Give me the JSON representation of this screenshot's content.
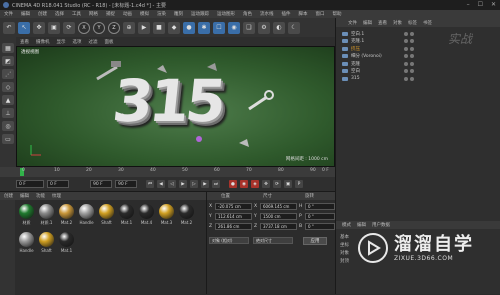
{
  "window": {
    "title": "CINEMA 4D R18.041 Studio (RC - R18) - [未标题-1.c4d *] - 主要"
  },
  "menubar": [
    "文件",
    "编辑",
    "创建",
    "选择",
    "工具",
    "网格",
    "捕捉",
    "动画",
    "模拟",
    "渲染",
    "雕刻",
    "运动跟踪",
    "运动图形",
    "角色",
    "流水线",
    "插件",
    "脚本",
    "窗口",
    "帮助"
  ],
  "toolbar": {
    "buttons": [
      "↶",
      "↖",
      "✥",
      "▣",
      "⟳"
    ],
    "axes": [
      "X",
      "Y",
      "Z"
    ],
    "more": [
      "⊕",
      "▶",
      "■",
      "◆",
      "●",
      "✱",
      "☐",
      "◉",
      "❑",
      "⚙",
      "◐",
      "☾"
    ]
  },
  "viewport": {
    "menu": [
      "查看",
      "摄像机",
      "显示",
      "选项",
      "过滤",
      "面板"
    ],
    "label": "透视视图",
    "main_text": "315",
    "grid_info": "网格间距 : 1000 cm"
  },
  "objects": {
    "menu": [
      "文件",
      "编辑",
      "查看",
      "对象",
      "标签",
      "书签"
    ],
    "rows": [
      {
        "name": "空白.1",
        "highlight": false
      },
      {
        "name": "克隆.1",
        "highlight": false
      },
      {
        "name": "挤压",
        "highlight": true
      },
      {
        "name": "细分 (Voronoi)",
        "highlight": false
      },
      {
        "name": "克隆",
        "highlight": false
      },
      {
        "name": "空白",
        "highlight": false
      },
      {
        "name": "315",
        "highlight": false
      }
    ]
  },
  "timeline": {
    "ticks": [
      "0",
      "10",
      "20",
      "30",
      "40",
      "50",
      "60",
      "70",
      "80",
      "90"
    ],
    "end_label": "0 F"
  },
  "playbar": {
    "start": "0 F",
    "current": "0 F",
    "end": "90 F",
    "max": "90 F"
  },
  "materials": {
    "menu": [
      "创建",
      "编辑",
      "功能",
      "纹理"
    ],
    "row1": [
      {
        "label": "材质",
        "color": "#1f7a2e"
      },
      {
        "label": "材质.1",
        "color": "#8a8a8a"
      },
      {
        "label": "Mat.2",
        "color": "#c9973a"
      },
      {
        "label": "Handle",
        "color": "#a0a0a0"
      },
      {
        "label": "Shaft",
        "color": "#d1a022"
      },
      {
        "label": "Mat.1",
        "color": "#2a2a2a"
      },
      {
        "label": "Mat.4",
        "color": "#2a2a2a"
      },
      {
        "label": "Mat.3",
        "color": "#d1a022"
      },
      {
        "label": "Mat.2",
        "color": "#2a2a2a"
      }
    ],
    "row2": [
      {
        "label": "Handle",
        "color": "#9a9a9a"
      },
      {
        "label": "Shaft",
        "color": "#d1a022"
      },
      {
        "label": "Mat.1",
        "color": "#2a2a2a"
      }
    ]
  },
  "coordinates": {
    "headers": [
      "位置",
      "尺寸",
      "旋转"
    ],
    "rows": [
      {
        "axis": "X",
        "pos": "-20.075 cm",
        "size": "6069.145 cm",
        "rot_label": "H",
        "rot": "0 °"
      },
      {
        "axis": "Y",
        "pos": "112.614 cm",
        "size": "1500 cm",
        "rot_label": "P",
        "rot": "0 °"
      },
      {
        "axis": "Z",
        "pos": "261.86 cm",
        "size": "3737.18 cm",
        "rot_label": "B",
        "rot": "0 °"
      }
    ],
    "mode1": "对象 (相对)",
    "mode2": "绝对尺寸",
    "apply": "应用"
  },
  "attributes": {
    "menu": [
      "模式",
      "编辑",
      "用户数据"
    ],
    "rows": [
      "基本",
      "坐标",
      "对象",
      "封顶"
    ]
  },
  "watermark": {
    "name": "溜溜自学",
    "url": "ZIXUE.3D66.COM",
    "top": "实战"
  }
}
